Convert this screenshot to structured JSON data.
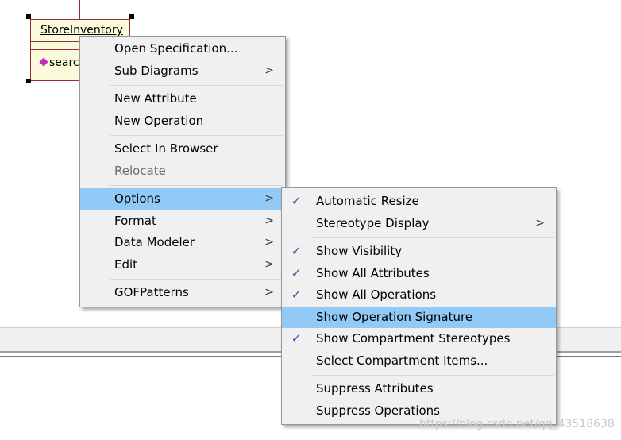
{
  "class_box": {
    "name": "StoreInventory",
    "operation": "searc"
  },
  "context_menu": {
    "groups": [
      [
        {
          "label": "Open Specification...",
          "has_submenu": false
        },
        {
          "label": "Sub Diagrams",
          "has_submenu": true
        }
      ],
      [
        {
          "label": "New Attribute",
          "has_submenu": false
        },
        {
          "label": "New Operation",
          "has_submenu": false
        }
      ],
      [
        {
          "label": "Select In Browser",
          "has_submenu": false
        },
        {
          "label": "Relocate",
          "has_submenu": false,
          "disabled": true
        }
      ],
      [
        {
          "label": "Options",
          "has_submenu": true,
          "highlighted": true
        },
        {
          "label": "Format",
          "has_submenu": true
        },
        {
          "label": "Data Modeler",
          "has_submenu": true
        },
        {
          "label": "Edit",
          "has_submenu": true
        }
      ],
      [
        {
          "label": "GOFPatterns",
          "has_submenu": true
        }
      ]
    ]
  },
  "options_submenu": {
    "groups": [
      [
        {
          "label": "Automatic Resize",
          "checked": true,
          "has_submenu": false
        },
        {
          "label": "Stereotype Display",
          "checked": false,
          "has_submenu": true
        }
      ],
      [
        {
          "label": "Show Visibility",
          "checked": true
        },
        {
          "label": "Show All Attributes",
          "checked": true
        },
        {
          "label": "Show All Operations",
          "checked": true
        },
        {
          "label": "Show Operation Signature",
          "checked": false,
          "highlighted": true
        },
        {
          "label": "Show Compartment Stereotypes",
          "checked": true
        },
        {
          "label": "Select Compartment Items...",
          "checked": false
        }
      ],
      [
        {
          "label": "Suppress Attributes",
          "checked": false
        },
        {
          "label": "Suppress Operations",
          "checked": false
        }
      ]
    ]
  },
  "symbols": {
    "submenu_arrow": ">",
    "check": "✓"
  },
  "watermark": "https://blog.csdn.net/qq_43518638",
  "colors": {
    "highlight": "#91c9f7",
    "menu_bg": "#f0f0f0",
    "class_fill": "#fbfbdc",
    "class_border": "#9b2b3a"
  }
}
